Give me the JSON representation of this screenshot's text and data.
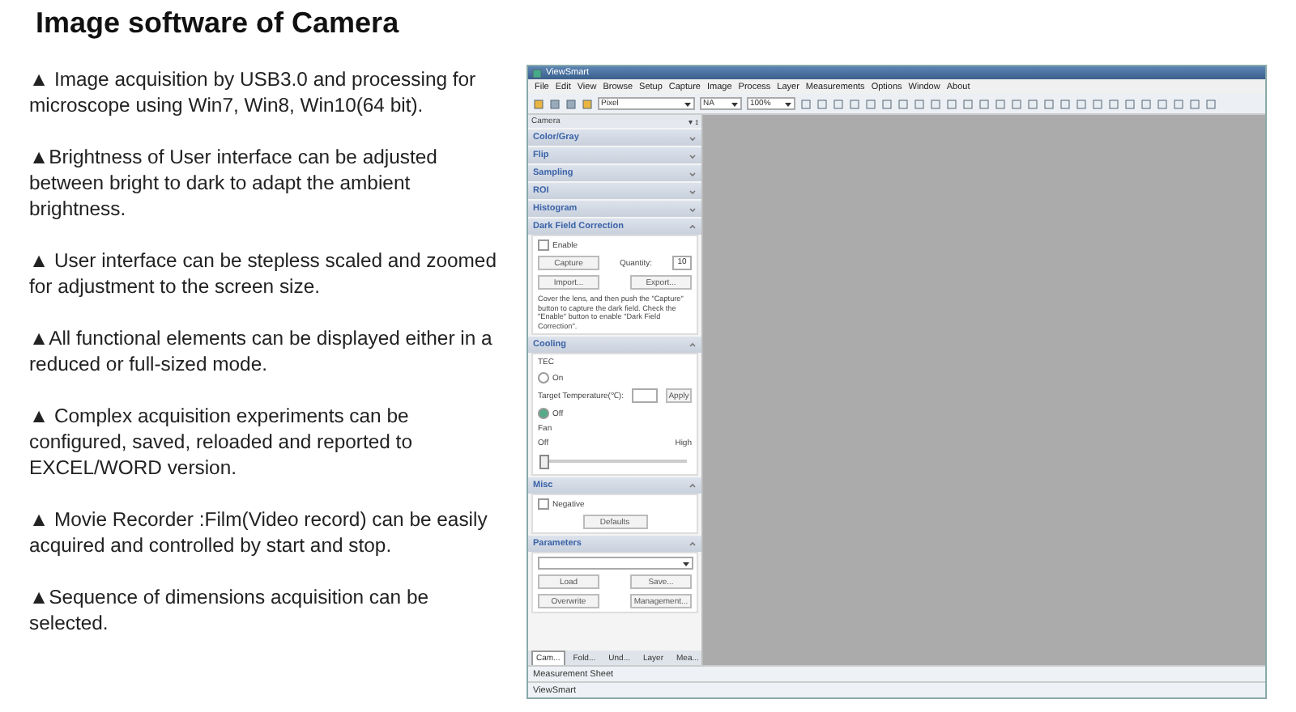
{
  "title": "Image software of Camera",
  "bullets": [
    {
      "marker": "▲",
      "text": " Image acquisition by USB3.0 and processing for microscope using Win7, Win8, Win10(64 bit)."
    },
    {
      "marker": "▲",
      "text": "Brightness of User interface can be adjusted between bright to dark to adapt the ambient brightness."
    },
    {
      "marker": "▲",
      "text": " User interface can be stepless scaled and zoomed for adjustment to the screen size."
    },
    {
      "marker": "▲",
      "text": "All functional elements can be displayed either in a reduced or full-sized mode."
    },
    {
      "marker": "▲",
      "text": " Complex acquisition experiments can be configured, saved, reloaded and reported to EXCEL/WORD version."
    },
    {
      "marker": "▲",
      "text": " Movie Recorder :Film(Video record) can be easily acquired and controlled by start and  stop."
    },
    {
      "marker": "▲",
      "text": "Sequence of dimensions acquisition can be selected."
    }
  ],
  "app": {
    "window_title": "ViewSmart",
    "menu": [
      "File",
      "Edit",
      "View",
      "Browse",
      "Setup",
      "Capture",
      "Image",
      "Process",
      "Layer",
      "Measurements",
      "Options",
      "Window",
      "About"
    ],
    "toolbar": {
      "unit": "Pixel",
      "selection": "NA",
      "zoom": "100%"
    },
    "panel": {
      "title": "Camera",
      "pin": "▾ ɪ",
      "sections": [
        {
          "title": "Color/Gray",
          "expanded": false
        },
        {
          "title": "Flip",
          "expanded": false
        },
        {
          "title": "Sampling",
          "expanded": false
        },
        {
          "title": "ROI",
          "expanded": false
        },
        {
          "title": "Histogram",
          "expanded": false
        },
        {
          "title": "Dark Field Correction",
          "expanded": true,
          "kind": "darkfield",
          "enable": {
            "label": "Enable",
            "checked": false
          },
          "capture": "Capture",
          "quantity_label": "Quantity:",
          "quantity": "10",
          "import": "Import...",
          "export": "Export...",
          "note": "Cover the lens, and then push the \"Capture\" button to capture the dark field. Check the \"Enable\" button to enable \"Dark Field Correction\"."
        },
        {
          "title": "Cooling",
          "expanded": true,
          "kind": "cooling",
          "tec_label": "TEC",
          "on": {
            "label": "On",
            "selected": false
          },
          "target_label": "Target Temperature(℃):",
          "apply": "Apply",
          "off": {
            "label": "Off",
            "selected": true
          },
          "fan_label": "Fan",
          "fan_min": "Off",
          "fan_max": "High",
          "fan": {
            "level": 0.0
          }
        },
        {
          "title": "Misc",
          "expanded": true,
          "kind": "misc",
          "negative": {
            "label": "Negative",
            "checked": false
          },
          "defaults": "Defaults"
        },
        {
          "title": "Parameters",
          "expanded": true,
          "kind": "parameters",
          "load": "Load",
          "save": "Save...",
          "overwrite": "Overwrite",
          "management": "Management..."
        }
      ]
    },
    "dock_tabs": [
      {
        "label": "Cam...",
        "selected": true
      },
      {
        "label": "Fold...",
        "selected": false
      },
      {
        "label": "Und...",
        "selected": false
      },
      {
        "label": "Layer",
        "selected": false
      },
      {
        "label": "Mea...",
        "selected": false
      }
    ],
    "sheet_tab": "Measurement Sheet",
    "taskbar_item": "ViewSmart"
  }
}
